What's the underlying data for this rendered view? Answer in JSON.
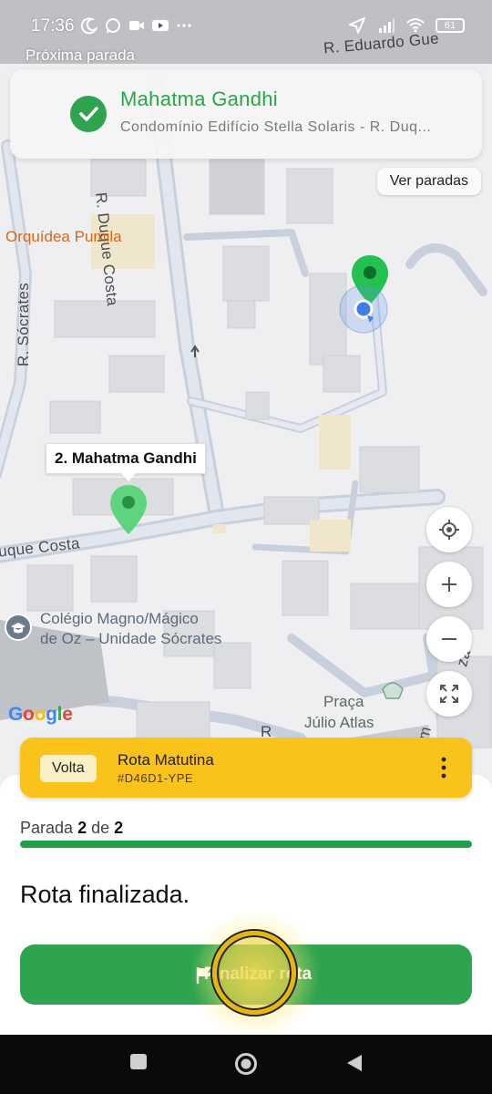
{
  "status_bar": {
    "time": "17:36",
    "battery": "61"
  },
  "header": {
    "next_stop_label": "Próxima parada"
  },
  "stop_card": {
    "title": "Mahatma Gandhi",
    "subtitle": "Condomínio Edifício Stella Solaris - R. Duq..."
  },
  "map": {
    "ver_paradas": "Ver paradas",
    "streets": {
      "eduardo": "R. Eduardo Gue",
      "duque_costa": "R. Duque Costa",
      "socrates": "R. Sócrates",
      "duque_costa_lower": "uque Costa",
      "r_lower": "R",
      "am": "Am",
      "za": "za"
    },
    "pois": {
      "orquidea": "Orquídea Pumila",
      "colegio_line1": "Colégio Magno/Mágico",
      "colegio_line2": "de Oz – Unidade Sócrates",
      "praca_line1": "Praça",
      "praca_line2": "Júlio Atlas"
    },
    "marker_tooltip": "2. Mahatma Gandhi",
    "google": "Google",
    "controls": [
      "my-location",
      "zoom-in",
      "zoom-out",
      "fullscreen"
    ]
  },
  "route_card": {
    "badge": "Volta",
    "name": "Rota Matutina",
    "code": "#D46D1-YPE"
  },
  "progress": {
    "prefix": "Parada",
    "current": "2",
    "middle": "de",
    "total": "2",
    "fraction": 1.0
  },
  "status_title": "Rota finalizada.",
  "finish_button": {
    "label": "Finalizar rota"
  },
  "colors": {
    "accent_green": "#2ea44f",
    "route_yellow": "#f9c31c",
    "poi_orange": "#d2691e",
    "poi_blue": "#3f6f9a"
  }
}
